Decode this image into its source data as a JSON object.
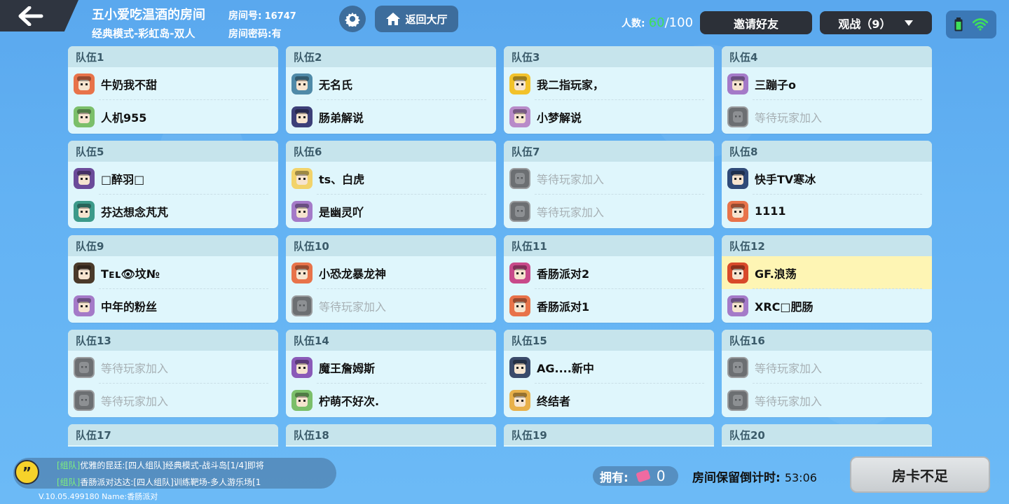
{
  "header": {
    "room_title": "五小爱吃温酒的房间",
    "room_mode": "经典模式-彩虹岛-双人",
    "room_no_label": "房间号:",
    "room_no": "16747",
    "room_pwd": "房间密码:有",
    "lobby_label": "返回大厅",
    "player_count_label": "人数:",
    "player_count_current": "60",
    "player_count_max": "/100",
    "invite_label": "邀请好友",
    "spectate_label": "观战（9）"
  },
  "empty_slot_text": "等待玩家加入",
  "teams": [
    {
      "label": "队伍1",
      "slots": [
        {
          "name": "牛奶我不甜",
          "color": "#e8734a",
          "empty": false
        },
        {
          "name": "人机955",
          "color": "#7bbf6a",
          "empty": false
        }
      ]
    },
    {
      "label": "队伍2",
      "slots": [
        {
          "name": "无名氏",
          "color": "#4f8aa8",
          "empty": false
        },
        {
          "name": "肠弟解说",
          "color": "#3c3f78",
          "empty": false
        }
      ]
    },
    {
      "label": "队伍3",
      "slots": [
        {
          "name": "我二指玩家，",
          "color": "#f2c22a",
          "empty": false
        },
        {
          "name": "小梦解说",
          "color": "#b88bc9",
          "empty": false
        }
      ]
    },
    {
      "label": "队伍4",
      "slots": [
        {
          "name": "三蹦子o",
          "color": "#a47ac8",
          "empty": false
        },
        {
          "name": "等待玩家加入",
          "color": "#6c6f72",
          "empty": true
        }
      ]
    },
    {
      "label": "队伍5",
      "slots": [
        {
          "name": "□醉羽□",
          "color": "#6b4b9a",
          "empty": false
        },
        {
          "name": "芬达想念芃芃",
          "color": "#3c9a8a",
          "empty": false
        }
      ]
    },
    {
      "label": "队伍6",
      "slots": [
        {
          "name": "ts、白虎",
          "color": "#f2d36a",
          "empty": false
        },
        {
          "name": "是幽灵吖",
          "color": "#a47ac8",
          "empty": false
        }
      ]
    },
    {
      "label": "队伍7",
      "slots": [
        {
          "name": "等待玩家加入",
          "color": "#6c6f72",
          "empty": true
        },
        {
          "name": "等待玩家加入",
          "color": "#6c6f72",
          "empty": true
        }
      ]
    },
    {
      "label": "队伍8",
      "slots": [
        {
          "name": "快手TV寒冰",
          "color": "#2f4a78",
          "empty": false
        },
        {
          "name": "1111",
          "color": "#e8734a",
          "empty": false
        }
      ]
    },
    {
      "label": "队伍9",
      "slots": [
        {
          "name": "Tᴇʟ👁坟№",
          "color": "#4a3a2a",
          "empty": false
        },
        {
          "name": "中年的粉丝",
          "color": "#a47ac8",
          "empty": false
        }
      ]
    },
    {
      "label": "队伍10",
      "slots": [
        {
          "name": "小恐龙暴龙神",
          "color": "#e8734a",
          "empty": false
        },
        {
          "name": "等待玩家加入",
          "color": "#6c6f72",
          "empty": true
        }
      ]
    },
    {
      "label": "队伍11",
      "slots": [
        {
          "name": "香肠派对2",
          "color": "#c84a8a",
          "empty": false
        },
        {
          "name": "香肠派对1",
          "color": "#e8734a",
          "empty": false
        }
      ]
    },
    {
      "label": "队伍12",
      "highlight_first": true,
      "slots": [
        {
          "name": "GF.浪荡",
          "color": "#d84a2a",
          "empty": false
        },
        {
          "name": "XRC□肥肠",
          "color": "#a47ac8",
          "empty": false
        }
      ]
    },
    {
      "label": "队伍13",
      "slots": [
        {
          "name": "等待玩家加入",
          "color": "#6c6f72",
          "empty": true
        },
        {
          "name": "等待玩家加入",
          "color": "#6c6f72",
          "empty": true
        }
      ]
    },
    {
      "label": "队伍14",
      "slots": [
        {
          "name": "魔王詹姆斯",
          "color": "#8a5ab8",
          "empty": false
        },
        {
          "name": "柠萌不好次.",
          "color": "#7bbf6a",
          "empty": false
        }
      ]
    },
    {
      "label": "队伍15",
      "slots": [
        {
          "name": "AG....新中",
          "color": "#3a4a6a",
          "empty": false
        },
        {
          "name": "终结者",
          "color": "#e8b04a",
          "empty": false
        }
      ]
    },
    {
      "label": "队伍16",
      "slots": [
        {
          "name": "等待玩家加入",
          "color": "#6c6f72",
          "empty": true
        },
        {
          "name": "等待玩家加入",
          "color": "#6c6f72",
          "empty": true
        }
      ]
    },
    {
      "label": "队伍17",
      "slots": []
    },
    {
      "label": "队伍18",
      "slots": []
    },
    {
      "label": "队伍19",
      "slots": []
    },
    {
      "label": "队伍20",
      "slots": []
    }
  ],
  "chat": {
    "line1_tag": "[组队]",
    "line1_text": "优雅的昆廷:[四人组队]经典模式-战斗岛[1/4]即将",
    "line2_tag": "[组队]",
    "line2_text": "香肠派对达达:[四人组队]训练靶场-多人游乐场[1"
  },
  "version": "V.10.05.499180 Name:香肠派对",
  "footer": {
    "own_label": "拥有:",
    "own_count": "0",
    "countdown_label": "房间保留倒计时:",
    "countdown_time": "53:06",
    "roomcard_label": "房卡不足"
  },
  "colors": {
    "accent_green": "#3fe05a",
    "dark_button": "#2c3038",
    "highlight_slot": "#fef5b4"
  }
}
